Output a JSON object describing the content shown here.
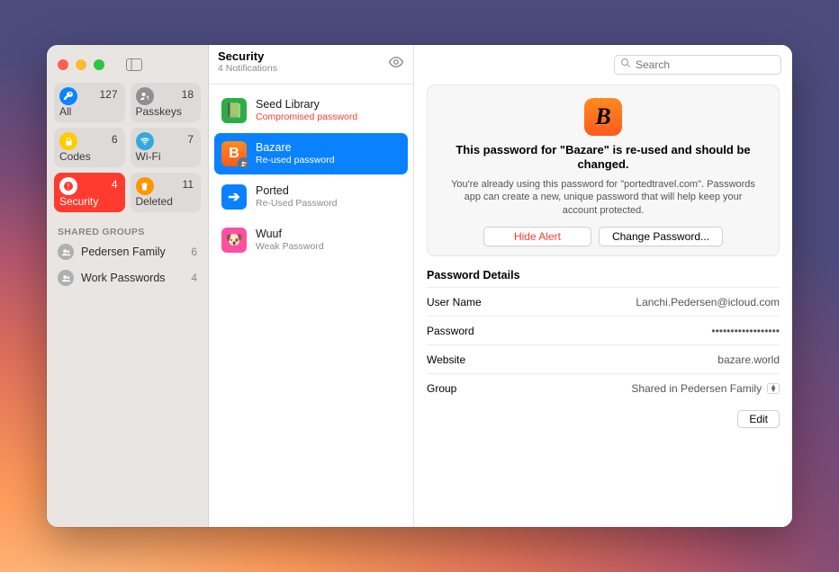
{
  "sidebar": {
    "categories": [
      {
        "id": "all",
        "label": "All",
        "count": "127"
      },
      {
        "id": "passkeys",
        "label": "Passkeys",
        "count": "18"
      },
      {
        "id": "codes",
        "label": "Codes",
        "count": "6"
      },
      {
        "id": "wifi",
        "label": "Wi-Fi",
        "count": "7"
      },
      {
        "id": "security",
        "label": "Security",
        "count": "4"
      },
      {
        "id": "deleted",
        "label": "Deleted",
        "count": "11"
      }
    ],
    "shared_header": "SHARED GROUPS",
    "shared_groups": [
      {
        "label": "Pedersen Family",
        "count": "6"
      },
      {
        "label": "Work Passwords",
        "count": "4"
      }
    ]
  },
  "list": {
    "title": "Security",
    "subtitle": "4 Notifications",
    "items": [
      {
        "title": "Seed Library",
        "subtitle": "Compromised password",
        "sub_style": "red",
        "icon_bg": "#2cae46",
        "icon_letter": "📗",
        "badged": false
      },
      {
        "title": "Bazare",
        "subtitle": "Re-used password",
        "sub_style": "",
        "icon_bg": "linear-gradient(#ff8a1e,#ff5a1e)",
        "icon_letter": "B",
        "badged": true
      },
      {
        "title": "Ported",
        "subtitle": "Re-Used Password",
        "sub_style": "",
        "icon_bg": "#0a82ff",
        "icon_letter": "➔",
        "badged": false
      },
      {
        "title": "Wuuf",
        "subtitle": "Weak Password",
        "sub_style": "",
        "icon_bg": "#ff4fa3",
        "icon_letter": "🐶",
        "badged": false
      }
    ],
    "selected_index": 1
  },
  "search": {
    "placeholder": "Search"
  },
  "alert": {
    "heading": "This password for \"Bazare\" is re-used and should be changed.",
    "body": "You're already using this password for \"portedtravel.com\". Passwords app can create a new, unique password that will help keep your account protected.",
    "hide_label": "Hide Alert",
    "change_label": "Change Password..."
  },
  "details": {
    "section_title": "Password Details",
    "rows": [
      {
        "key": "User Name",
        "value": "Lanchi.Pedersen@icloud.com"
      },
      {
        "key": "Password",
        "value": "••••••••••••••••••"
      },
      {
        "key": "Website",
        "value": "bazare.world"
      },
      {
        "key": "Group",
        "value": "Shared in Pedersen Family"
      }
    ],
    "edit_label": "Edit"
  }
}
